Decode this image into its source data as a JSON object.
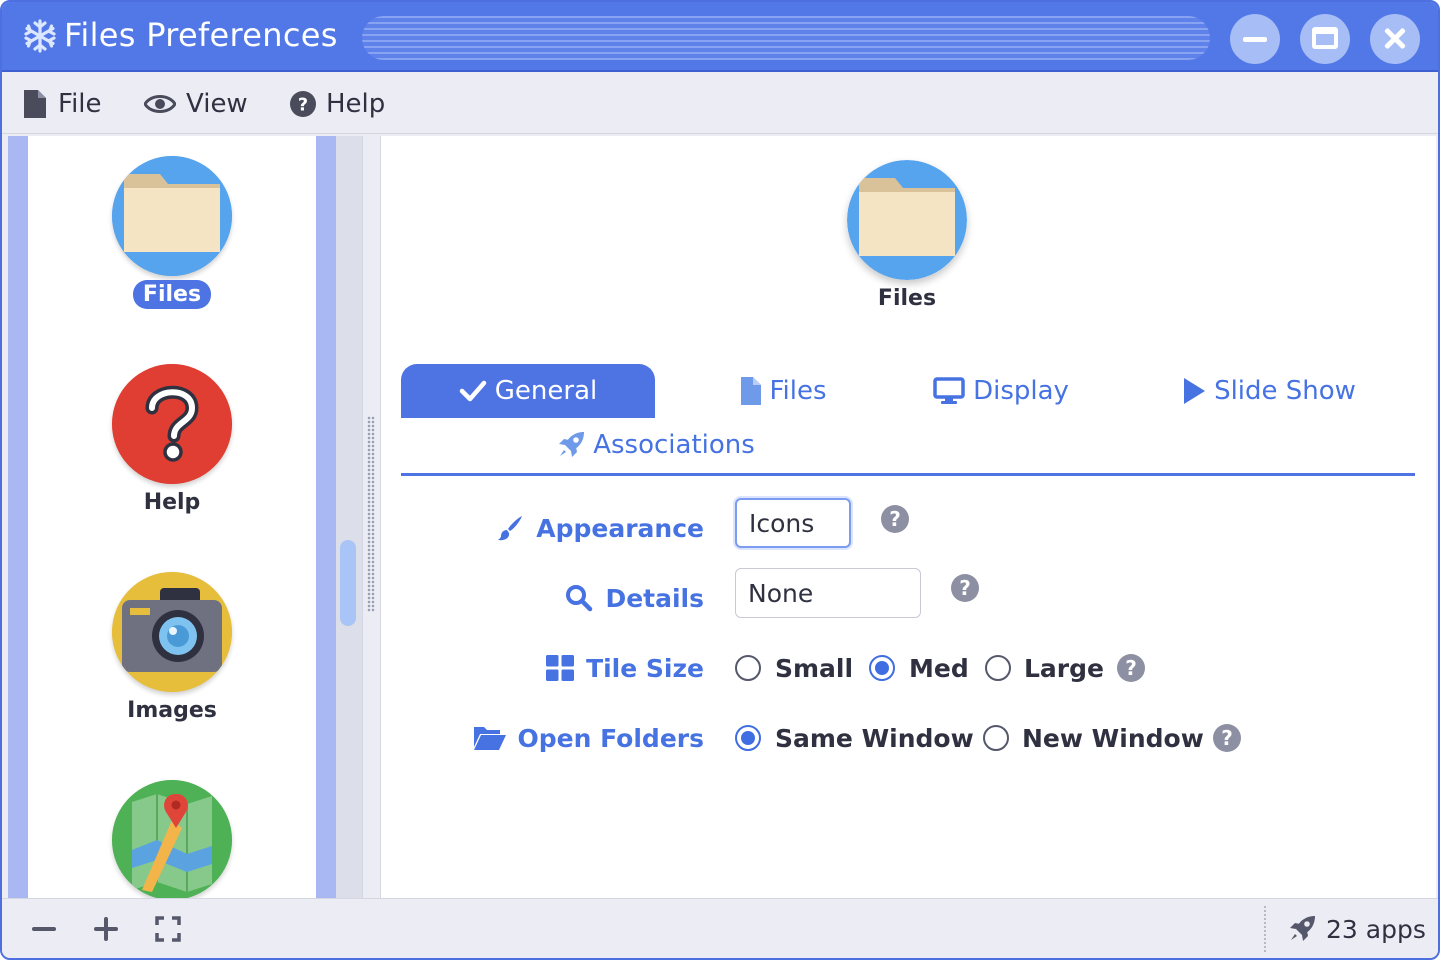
{
  "window": {
    "title": "Files Preferences",
    "icon": "snowflake-icon",
    "controls": [
      "minimize",
      "maximize",
      "close"
    ],
    "accent_color": "#5277e6"
  },
  "menu": {
    "items": [
      {
        "label": "File",
        "icon": "file-icon"
      },
      {
        "label": "View",
        "icon": "eye-icon"
      },
      {
        "label": "Help",
        "icon": "question-circle-icon"
      }
    ]
  },
  "sidebar": {
    "items": [
      {
        "label": "Files",
        "icon": "folder-icon",
        "selected": true
      },
      {
        "label": "Help",
        "icon": "help-icon",
        "selected": false
      },
      {
        "label": "Images",
        "icon": "camera-icon",
        "selected": false
      },
      {
        "label": "",
        "icon": "map-icon",
        "selected": false
      }
    ]
  },
  "header": {
    "icon": "folder-icon",
    "label": "Files"
  },
  "tabs": [
    {
      "label": "General",
      "icon": "check-icon",
      "active": true
    },
    {
      "label": "Files",
      "icon": "file-icon",
      "active": false
    },
    {
      "label": "Display",
      "icon": "monitor-icon",
      "active": false
    },
    {
      "label": "Slide Show",
      "icon": "play-icon",
      "active": false
    },
    {
      "label": "Associations",
      "icon": "rocket-icon",
      "active": false
    }
  ],
  "settings": {
    "appearance": {
      "label": "Appearance",
      "value": "Icons",
      "icon": "brush-icon"
    },
    "details": {
      "label": "Details",
      "value": "None",
      "icon": "search-icon"
    },
    "tile_size": {
      "label": "Tile Size",
      "icon": "grid-icon",
      "options": [
        "Small",
        "Med",
        "Large"
      ],
      "selected": "Med"
    },
    "open_folders": {
      "label": "Open Folders",
      "icon": "folder-open-icon",
      "options": [
        "Same Window",
        "New Window"
      ],
      "selected": "Same Window"
    }
  },
  "statusbar": {
    "buttons": [
      "zoom-out",
      "zoom-in",
      "fullscreen"
    ],
    "app_count": "23 apps",
    "icon": "rocket-icon"
  }
}
